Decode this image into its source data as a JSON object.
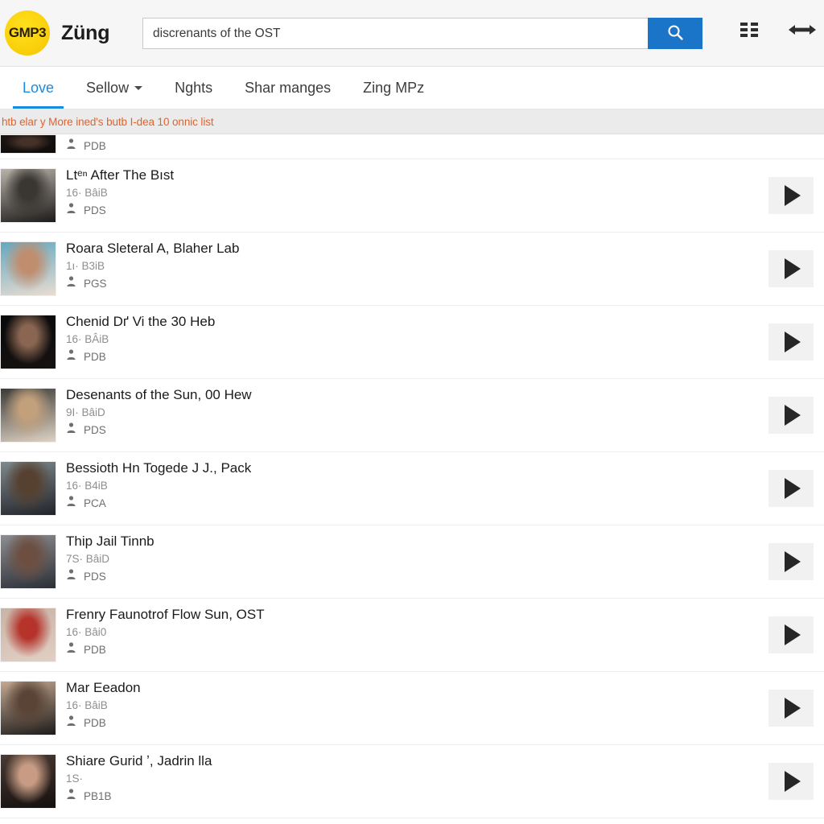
{
  "header": {
    "logo_badge": "GMP3",
    "logo_word": "Züng",
    "search": {
      "value": "discrenants of the OST",
      "placeholder": "discrenants of the OST",
      "button_icon": "search-icon"
    },
    "icons": [
      {
        "name": "grid-menu-icon"
      },
      {
        "name": "expand-horizontal-icon"
      }
    ]
  },
  "nav": {
    "items": [
      {
        "label": "Love",
        "active": true,
        "has_caret": false
      },
      {
        "label": "Sellow",
        "active": false,
        "has_caret": true
      },
      {
        "label": "Nghts",
        "active": false,
        "has_caret": false
      },
      {
        "label": "Shar manges",
        "active": false,
        "has_caret": false
      },
      {
        "label": "Zing MPz",
        "active": false,
        "has_caret": false
      }
    ]
  },
  "notice": {
    "text": "htb elar y More ined's butb I-dea 10 onnic list",
    "color": "#e2622c",
    "background": "#ebebeb"
  },
  "results": {
    "play_label": "Play",
    "rows": [
      {
        "clipped": true,
        "title": "",
        "sub": "",
        "source": "PDB",
        "thumb_colors": [
          "#1a1411",
          "#443128",
          "#100c0a"
        ],
        "has_play": true
      },
      {
        "clipped": false,
        "title": "Ltᵉⁿ After The Bıst",
        "sub": "16· BâiB",
        "source": "PDS",
        "thumb_colors": [
          "#b9b3aa",
          "#3a3632",
          "#1d1b1a"
        ],
        "has_play": true
      },
      {
        "clipped": false,
        "title": "Roara Sleteral A, Blaher Lab",
        "sub": "1ı· B3iB",
        "source": "PGS",
        "thumb_colors": [
          "#63a8c0",
          "#c08d6e",
          "#e8dcd2"
        ],
        "has_play": true
      },
      {
        "clipped": false,
        "title": "Chenid Dґ Vi the 30 Heb",
        "sub": "16· BÂiB",
        "source": "PDB",
        "thumb_colors": [
          "#090909",
          "#8a6652",
          "#161212"
        ],
        "has_play": true
      },
      {
        "clipped": false,
        "title": "Desenants of the Sun, 00 Hew",
        "sub": "9I· BâiD",
        "source": "PDS",
        "thumb_colors": [
          "#3c3a36",
          "#c2a07c",
          "#ded3c4"
        ],
        "has_play": true
      },
      {
        "clipped": false,
        "title": "Bessioth Hn Togede J J., Pack",
        "sub": "16· B4iB",
        "source": "PCA",
        "thumb_colors": [
          "#7f8a8e",
          "#56402f",
          "#22242a"
        ],
        "has_play": true
      },
      {
        "clipped": false,
        "title": "Thip Jail Tinnb",
        "sub": "7S· BâiD",
        "source": "PDS",
        "thumb_colors": [
          "#8d8e92",
          "#6d4f42",
          "#2c2f36"
        ],
        "has_play": true
      },
      {
        "clipped": false,
        "title": "Frenry Faunotrof Flow Sun, OST",
        "sub": "16· Bâi0",
        "source": "PDB",
        "thumb_colors": [
          "#c8b4a6",
          "#b5332b",
          "#e2cfc4"
        ],
        "has_play": true
      },
      {
        "clipped": false,
        "title": "Mar Eeadon",
        "sub": "16· BâiB",
        "source": "PDB",
        "thumb_colors": [
          "#c4a891",
          "#5a4436",
          "#1e1c1b"
        ],
        "has_play": true
      },
      {
        "clipped": false,
        "title": "Shiare Gurid ʼ, Jadrin lla",
        "sub": "1S·",
        "source": "PB1B",
        "thumb_colors": [
          "#4a3a33",
          "#c89c84",
          "#14100e"
        ],
        "has_play": true
      }
    ]
  }
}
